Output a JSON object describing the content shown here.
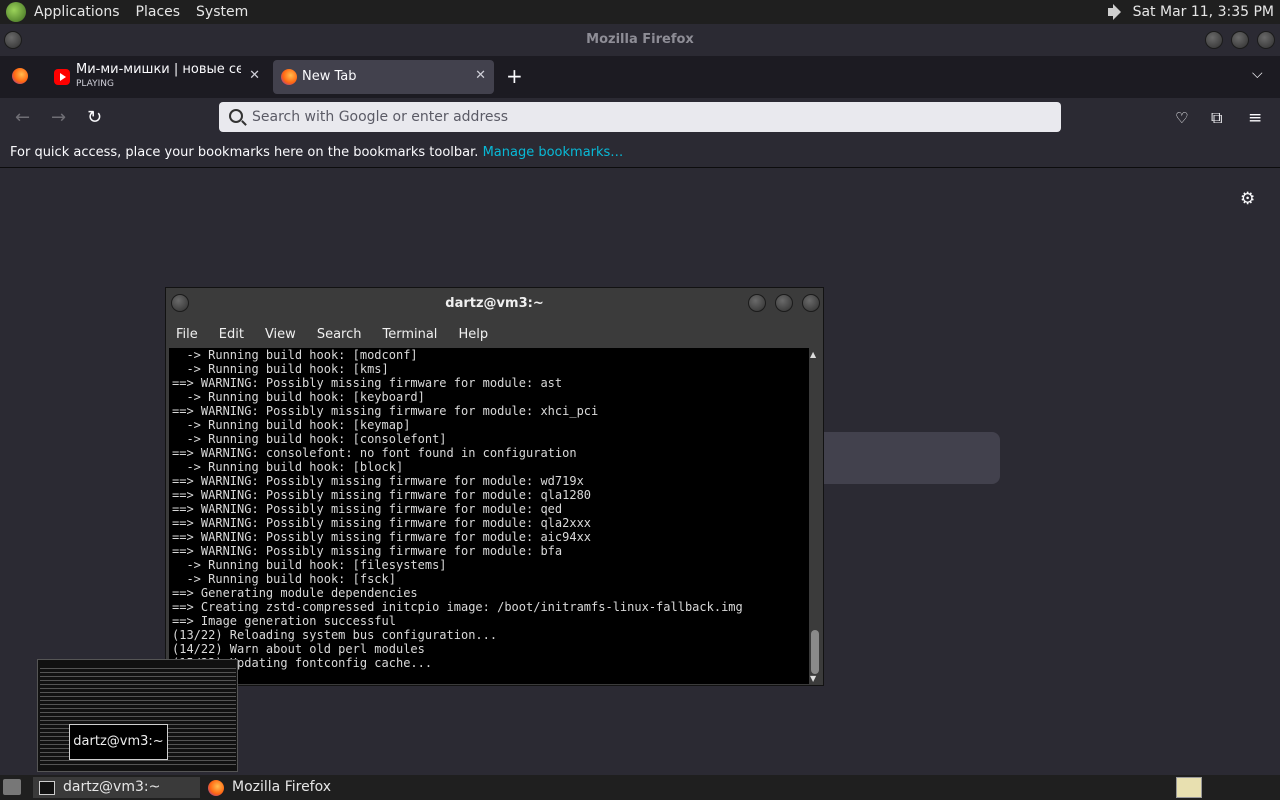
{
  "top_panel": {
    "menus": [
      "Applications",
      "Places",
      "System"
    ],
    "clock": "Sat Mar 11,  3:35 PM",
    "volume_icon": "speaker-icon"
  },
  "firefox": {
    "window_title": "Mozilla Firefox",
    "tabs": [
      {
        "title": "Ми-ми-мишки | новые сери",
        "subtitle": "PLAYING",
        "icon": "youtube-icon"
      },
      {
        "title": "New Tab",
        "icon": "firefox-icon"
      }
    ],
    "new_tab_label": "+",
    "url_placeholder": "Search with Google or enter address",
    "bookmarks_text": "For quick access, place your bookmarks here on the bookmarks toolbar.",
    "bookmarks_link": "Manage bookmarks…"
  },
  "terminal": {
    "title": "dartz@vm3:~",
    "menu": [
      "File",
      "Edit",
      "View",
      "Search",
      "Terminal",
      "Help"
    ],
    "lines": [
      "  -> Running build hook: [modconf]",
      "  -> Running build hook: [kms]",
      "==> WARNING: Possibly missing firmware for module: ast",
      "  -> Running build hook: [keyboard]",
      "==> WARNING: Possibly missing firmware for module: xhci_pci",
      "  -> Running build hook: [keymap]",
      "  -> Running build hook: [consolefont]",
      "==> WARNING: consolefont: no font found in configuration",
      "  -> Running build hook: [block]",
      "==> WARNING: Possibly missing firmware for module: wd719x",
      "==> WARNING: Possibly missing firmware for module: qla1280",
      "==> WARNING: Possibly missing firmware for module: qed",
      "==> WARNING: Possibly missing firmware for module: qla2xxx",
      "==> WARNING: Possibly missing firmware for module: aic94xx",
      "==> WARNING: Possibly missing firmware for module: bfa",
      "  -> Running build hook: [filesystems]",
      "  -> Running build hook: [fsck]",
      "==> Generating module dependencies",
      "==> Creating zstd-compressed initcpio image: /boot/initramfs-linux-fallback.img",
      "==> Image generation successful",
      "(13/22) Reloading system bus configuration...",
      "(14/22) Warn about old perl modules",
      "(15/22) Updating fontconfig cache..."
    ]
  },
  "preview": {
    "label": "dartz@vm3:~"
  },
  "taskbar": {
    "items": [
      {
        "label": "dartz@vm3:~",
        "icon": "terminal-icon"
      },
      {
        "label": "Mozilla Firefox",
        "icon": "firefox-icon"
      }
    ]
  }
}
